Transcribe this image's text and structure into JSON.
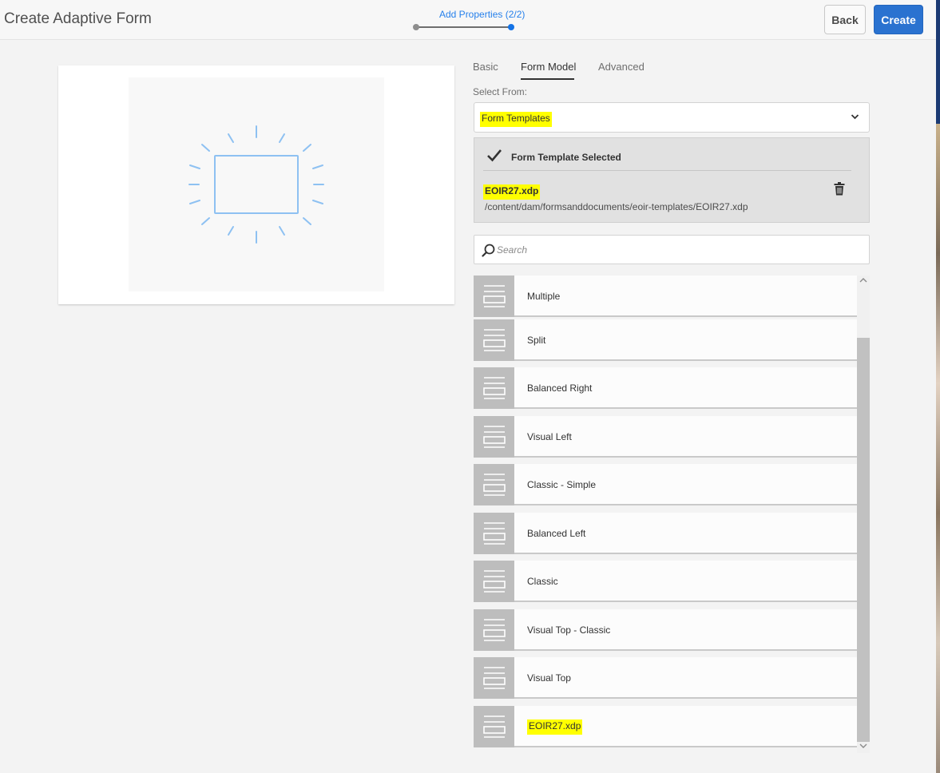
{
  "header": {
    "title": "Create Adaptive Form",
    "step_label": "Add Properties (2/2)",
    "back_label": "Back",
    "create_label": "Create",
    "accent_color": "#2a72d0"
  },
  "tabs": [
    {
      "label": "Basic"
    },
    {
      "label": "Form Model"
    },
    {
      "label": "Advanced"
    }
  ],
  "form_model": {
    "select_from_label": "Select From:",
    "select_from_value": "Form Templates",
    "selected_title": "Form Template Selected",
    "selected_file": "EOIR27.xdp",
    "selected_path": "/content/dam/formsanddocuments/eoir-templates/EOIR27.xdp"
  },
  "search": {
    "placeholder": "Search"
  },
  "templates": [
    {
      "label": "Multiple"
    },
    {
      "label": "Split"
    },
    {
      "label": "Balanced Right"
    },
    {
      "label": "Visual Left"
    },
    {
      "label": "Classic - Simple"
    },
    {
      "label": "Balanced Left"
    },
    {
      "label": "Classic"
    },
    {
      "label": "Visual Top - Classic"
    },
    {
      "label": "Visual Top"
    },
    {
      "label": "EOIR27.xdp"
    }
  ],
  "icons": {
    "preview": "form-preview-icon",
    "check": "checkmark-icon",
    "trash": "trash-icon",
    "search": "search-icon",
    "thumbnail": "template-thumbnail-icon",
    "chevron": "chevron-down-icon"
  },
  "highlight_color": "#ffff00"
}
